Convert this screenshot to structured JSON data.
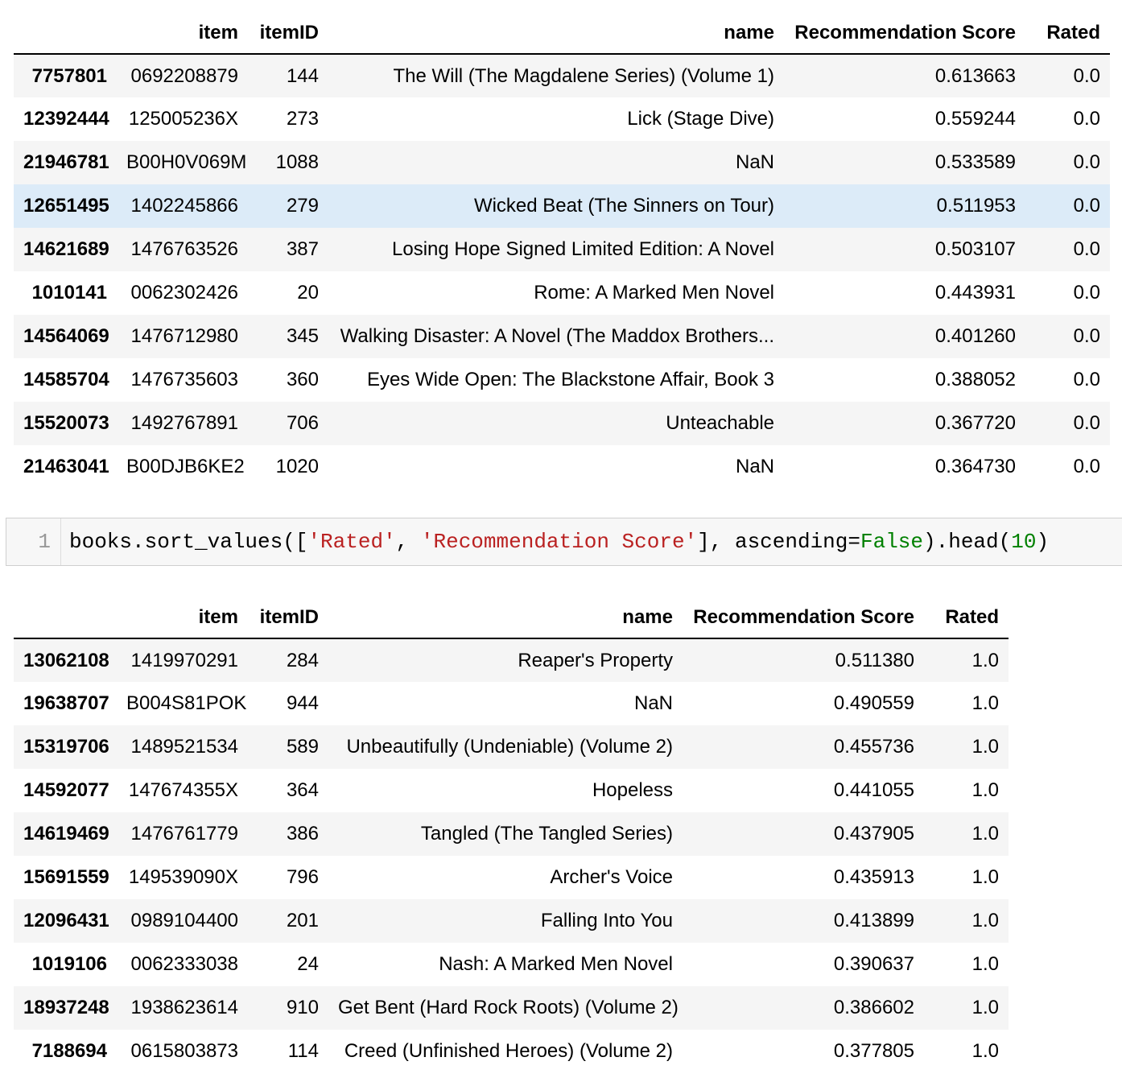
{
  "columns": {
    "index": "",
    "item": "item",
    "itemID": "itemID",
    "name": "name",
    "score": "Recommendation Score",
    "rated": "Rated"
  },
  "table_top": {
    "rows": [
      {
        "idx": "7757801",
        "item": "0692208879",
        "itemID": "144",
        "name": "The Will (The Magdalene Series) (Volume 1)",
        "score": "0.613663",
        "rated": "0.0"
      },
      {
        "idx": "12392444",
        "item": "125005236X",
        "itemID": "273",
        "name": "Lick (Stage Dive)",
        "score": "0.559244",
        "rated": "0.0"
      },
      {
        "idx": "21946781",
        "item": "B00H0V069M",
        "itemID": "1088",
        "name": "NaN",
        "score": "0.533589",
        "rated": "0.0"
      },
      {
        "idx": "12651495",
        "item": "1402245866",
        "itemID": "279",
        "name": "Wicked Beat (The Sinners on Tour)",
        "score": "0.511953",
        "rated": "0.0"
      },
      {
        "idx": "14621689",
        "item": "1476763526",
        "itemID": "387",
        "name": "Losing Hope Signed Limited Edition: A Novel",
        "score": "0.503107",
        "rated": "0.0"
      },
      {
        "idx": "1010141",
        "item": "0062302426",
        "itemID": "20",
        "name": "Rome: A Marked Men Novel",
        "score": "0.443931",
        "rated": "0.0"
      },
      {
        "idx": "14564069",
        "item": "1476712980",
        "itemID": "345",
        "name": "Walking Disaster: A Novel (The Maddox Brothers...",
        "score": "0.401260",
        "rated": "0.0"
      },
      {
        "idx": "14585704",
        "item": "1476735603",
        "itemID": "360",
        "name": "Eyes Wide Open: The Blackstone Affair, Book 3",
        "score": "0.388052",
        "rated": "0.0"
      },
      {
        "idx": "15520073",
        "item": "1492767891",
        "itemID": "706",
        "name": "Unteachable",
        "score": "0.367720",
        "rated": "0.0"
      },
      {
        "idx": "21463041",
        "item": "B00DJB6KE2",
        "itemID": "1020",
        "name": "NaN",
        "score": "0.364730",
        "rated": "0.0"
      }
    ]
  },
  "code_cell": {
    "line_number": "1",
    "code_prefix": "books.sort_values([",
    "str1": "'Rated'",
    "sep": ", ",
    "str2": "'Recommendation Score'",
    "mid": "], ascending=",
    "kw": "False",
    "tail1": ").head(",
    "num": "10",
    "tail2": ")"
  },
  "table_bottom": {
    "rows": [
      {
        "idx": "13062108",
        "item": "1419970291",
        "itemID": "284",
        "name": "Reaper's Property",
        "score": "0.511380",
        "rated": "1.0"
      },
      {
        "idx": "19638707",
        "item": "B004S81POK",
        "itemID": "944",
        "name": "NaN",
        "score": "0.490559",
        "rated": "1.0"
      },
      {
        "idx": "15319706",
        "item": "1489521534",
        "itemID": "589",
        "name": "Unbeautifully (Undeniable) (Volume 2)",
        "score": "0.455736",
        "rated": "1.0"
      },
      {
        "idx": "14592077",
        "item": "147674355X",
        "itemID": "364",
        "name": "Hopeless",
        "score": "0.441055",
        "rated": "1.0"
      },
      {
        "idx": "14619469",
        "item": "1476761779",
        "itemID": "386",
        "name": "Tangled (The Tangled Series)",
        "score": "0.437905",
        "rated": "1.0"
      },
      {
        "idx": "15691559",
        "item": "149539090X",
        "itemID": "796",
        "name": "Archer's Voice",
        "score": "0.435913",
        "rated": "1.0"
      },
      {
        "idx": "12096431",
        "item": "0989104400",
        "itemID": "201",
        "name": "Falling Into You",
        "score": "0.413899",
        "rated": "1.0"
      },
      {
        "idx": "1019106",
        "item": "0062333038",
        "itemID": "24",
        "name": "Nash: A Marked Men Novel",
        "score": "0.390637",
        "rated": "1.0"
      },
      {
        "idx": "18937248",
        "item": "1938623614",
        "itemID": "910",
        "name": "Get Bent (Hard Rock Roots) (Volume 2)",
        "score": "0.386602",
        "rated": "1.0"
      },
      {
        "idx": "7188694",
        "item": "0615803873",
        "itemID": "114",
        "name": "Creed (Unfinished Heroes) (Volume 2)",
        "score": "0.377805",
        "rated": "1.0"
      }
    ]
  },
  "colors": {
    "row_stripe": "#f5f5f5",
    "row_hover": "#dcebf8",
    "string_token": "#ba2121",
    "keyword_token": "#008000"
  }
}
